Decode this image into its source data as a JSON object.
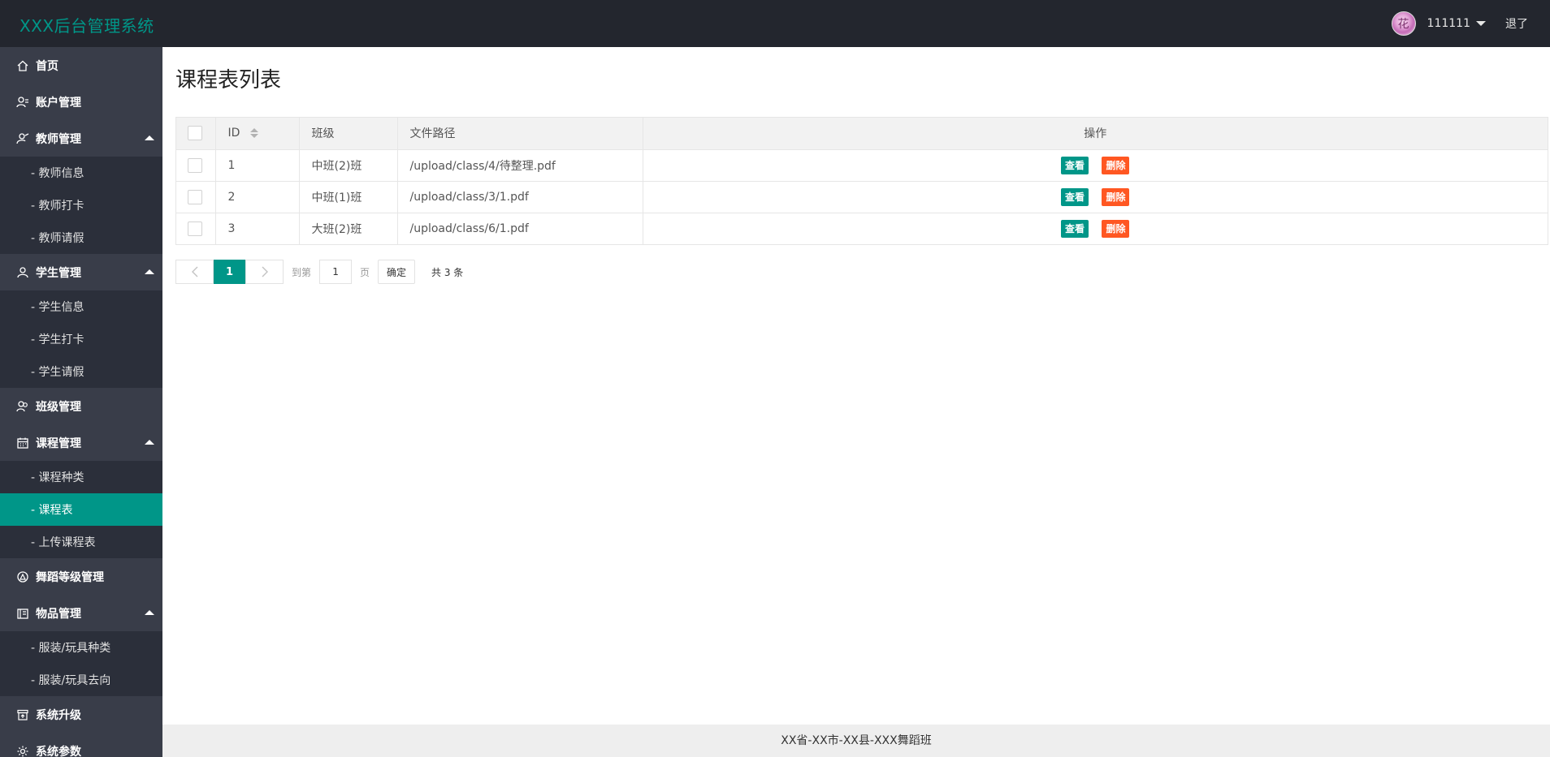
{
  "header": {
    "logo": "XXX后台管理系统",
    "avatar_glyph": "花",
    "username": "111111",
    "logout": "退了"
  },
  "sidebar": {
    "items": [
      {
        "label": "首页",
        "icon": "home-icon"
      },
      {
        "label": "账户管理",
        "icon": "user-list-icon"
      },
      {
        "label": "教师管理",
        "icon": "teacher-icon",
        "expanded": true,
        "children": [
          "- 教师信息",
          "- 教师打卡",
          "- 教师请假"
        ]
      },
      {
        "label": "学生管理",
        "icon": "student-icon",
        "expanded": true,
        "children": [
          "- 学生信息",
          "- 学生打卡",
          "- 学生请假"
        ]
      },
      {
        "label": "班级管理",
        "icon": "class-icon"
      },
      {
        "label": "课程管理",
        "icon": "calendar-icon",
        "expanded": true,
        "children": [
          "- 课程种类",
          "- 课程表",
          "- 上传课程表"
        ],
        "active_child": "- 课程表"
      },
      {
        "label": "舞蹈等级管理",
        "icon": "level-icon"
      },
      {
        "label": "物品管理",
        "icon": "goods-icon",
        "expanded": true,
        "children": [
          "- 服装/玩具种类",
          "- 服装/玩具去向"
        ]
      },
      {
        "label": "系统升级",
        "icon": "upgrade-icon"
      },
      {
        "label": "系统参数",
        "icon": "gear-icon"
      }
    ]
  },
  "main": {
    "title": "课程表列表",
    "table": {
      "columns": [
        "ID",
        "班级",
        "文件路径",
        "操作"
      ],
      "rows": [
        {
          "id": "1",
          "class": "中班(2)班",
          "path": "/upload/class/4/待整理.pdf"
        },
        {
          "id": "2",
          "class": "中班(1)班",
          "path": "/upload/class/3/1.pdf"
        },
        {
          "id": "3",
          "class": "大班(2)班",
          "path": "/upload/class/6/1.pdf"
        }
      ],
      "view_label": "查看",
      "delete_label": "删除"
    },
    "pager": {
      "current_page": "1",
      "goto_label": "到第",
      "goto_value": "1",
      "page_label": "页",
      "confirm_label": "确定",
      "total_label": "共 3 条"
    }
  },
  "footer": {
    "text": "XX省-XX市-XX县-XXX舞蹈班"
  },
  "colors": {
    "header_bg": "#23262e",
    "sidebar_bg": "#2b2f3a",
    "sidebar_parent_bg": "#393d49",
    "accent": "#009688",
    "danger": "#ff5722"
  }
}
